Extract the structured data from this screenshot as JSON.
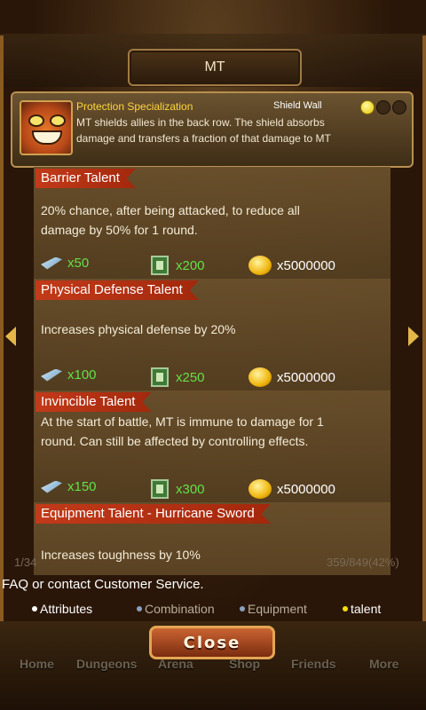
{
  "title": "MT",
  "hero": {
    "skill_name": "Protection Specialization",
    "skill_type": "Shield Wall",
    "stars_filled": 1,
    "stars_total": 3,
    "description": "MT shields allies in the back row. The shield absorbs damage and transfers a fraction of that damage to MT"
  },
  "talents": [
    {
      "name": "Barrier Talent",
      "description": "20% chance, after being attacked, to reduce all damage by 50% for 1 round.",
      "costs": {
        "feather": "x50",
        "book": "x200",
        "gold": "x5000000"
      }
    },
    {
      "name": "Physical Defense Talent",
      "description": "Increases physical defense by 20%",
      "costs": {
        "feather": "x100",
        "book": "x250",
        "gold": "x5000000"
      }
    },
    {
      "name": "Invincible Talent",
      "description": "At the start of battle, MT is immune to damage for 1 round. Can still be affected by controlling effects.",
      "costs": {
        "feather": "x150",
        "book": "x300",
        "gold": "x5000000"
      }
    },
    {
      "name": "Equipment Talent - Hurricane Sword",
      "description": "Increases toughness by 10%",
      "costs": {
        "feather": "",
        "book": "",
        "gold": ""
      }
    }
  ],
  "footer": {
    "pager": "1/34",
    "progress": "359/849(42%)",
    "faq": "FAQ or contact Customer Service."
  },
  "tabs": [
    {
      "label": "Attributes",
      "active": true,
      "bullet_color": "#ffffff"
    },
    {
      "label": "Combination",
      "active": false,
      "bullet_color": "#8aa0c0"
    },
    {
      "label": "Equipment",
      "active": false,
      "bullet_color": "#8aa0c0"
    },
    {
      "label": "talent",
      "active": true,
      "bullet_color": "#f5e000"
    }
  ],
  "close_label": "Close",
  "bottom_nav": [
    "Home",
    "Dungeons",
    "Arena",
    "Shop",
    "Friends",
    "More"
  ],
  "colors": {
    "banner_red": "#c23a1a",
    "cost_green": "#63e04a",
    "skill_gold": "#ffd53d"
  }
}
